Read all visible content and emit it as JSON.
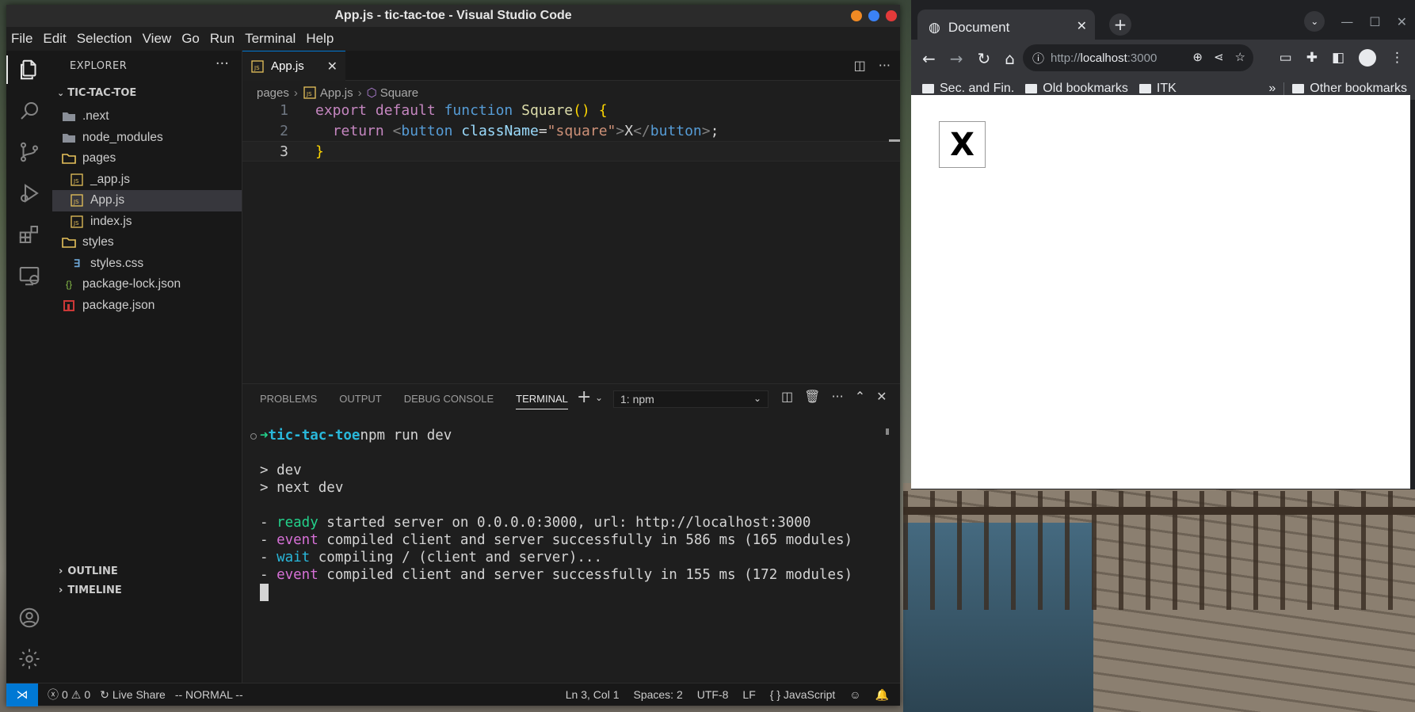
{
  "vscode": {
    "window_title": "App.js - tic-tac-toe - Visual Studio Code",
    "menu": [
      "File",
      "Edit",
      "Selection",
      "View",
      "Go",
      "Run",
      "Terminal",
      "Help"
    ],
    "explorer": {
      "header": "EXPLORER",
      "folder": "TIC-TAC-TOE",
      "items": [
        {
          "label": ".next",
          "type": "folder"
        },
        {
          "label": "node_modules",
          "type": "folder"
        },
        {
          "label": "pages",
          "type": "folder-open"
        },
        {
          "label": "_app.js",
          "type": "js"
        },
        {
          "label": "App.js",
          "type": "js",
          "selected": true
        },
        {
          "label": "index.js",
          "type": "js"
        },
        {
          "label": "styles",
          "type": "folder-open"
        },
        {
          "label": "styles.css",
          "type": "css"
        },
        {
          "label": "package-lock.json",
          "type": "json-lock"
        },
        {
          "label": "package.json",
          "type": "npm"
        }
      ],
      "outline": "OUTLINE",
      "timeline": "TIMELINE"
    },
    "tab": {
      "label": "App.js",
      "icon": "js-file-icon"
    },
    "breadcrumb": {
      "folder": "pages",
      "file": "App.js",
      "symbol": "Square"
    },
    "code": {
      "line_numbers": [
        "1",
        "2",
        "3"
      ],
      "l1": {
        "export": "export",
        "default": "default",
        "function": "function",
        "name": "Square",
        "paren": "()",
        "brace": "{"
      },
      "l2": {
        "return": "return",
        "lt": "<",
        "tag": "button",
        "attr": "className",
        "eq": "=",
        "value": "\"square\"",
        "gt": ">",
        "text": "X",
        "close_lt": "</",
        "close_tag": "button",
        "close_gt": ">",
        "semi": ";"
      },
      "l3": {
        "brace": "}"
      }
    },
    "panel": {
      "tabs": [
        "PROBLEMS",
        "OUTPUT",
        "DEBUG CONSOLE",
        "TERMINAL"
      ],
      "active_tab": "TERMINAL",
      "terminal_select": "1: npm",
      "terminal": {
        "prompt_arrow": "➜",
        "prompt_dir": "tic-tac-toe",
        "prompt_cmd": "npm run dev",
        "out1": "> dev",
        "out2": "> next dev",
        "r1_dash": "- ",
        "r1_kw": "ready",
        "r1_msg": " started server on 0.0.0.0:3000, url: http://localhost:3000",
        "r2_kw": "event",
        "r2_msg": " compiled client and server successfully in 586 ms (165 modules)",
        "r3_kw": "wait",
        "r3_msg": " compiling / (client and server)...",
        "r4_kw": "event",
        "r4_msg": " compiled client and server successfully in 155 ms (172 modules)"
      }
    },
    "status": {
      "errors": "0",
      "warnings": "0",
      "live_share": "Live Share",
      "mode": "-- NORMAL --",
      "position": "Ln 3, Col 1",
      "spaces": "Spaces: 2",
      "encoding": "UTF-8",
      "eol": "LF",
      "language": "JavaScript",
      "language_icon": "{ }"
    }
  },
  "chrome": {
    "tab_title": "Document",
    "url_scheme": "http://",
    "url_host": "localhost",
    "url_port": ":3000",
    "bookmarks": [
      "Sec. and Fin.",
      "Old bookmarks",
      "ITK"
    ],
    "overflow": "»",
    "other_bookmarks": "Other bookmarks",
    "page": {
      "square_text": "X"
    }
  }
}
